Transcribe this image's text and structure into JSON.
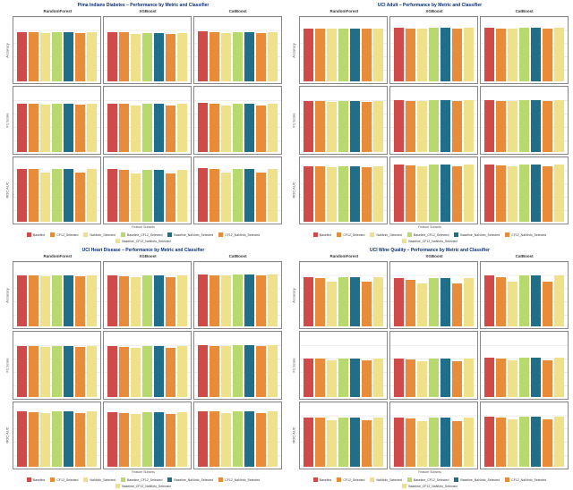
{
  "colors": [
    "#d14a4a",
    "#e98c3a",
    "#efe08a",
    "#b7d96e",
    "#1f6f8b",
    "#e98c3a",
    "#efe08a",
    "#1f6f8b"
  ],
  "panels": [
    {
      "title": "Pima Indians Diabetes – Performance by Metric and Classifier"
    },
    {
      "title": "UCI Adult – Performance by Metric and Classifier"
    },
    {
      "title": "UCI Heart Disease – Performance by Metric and Classifier"
    },
    {
      "title": "UCI Wine Quality – Performance by Metric and Classifier"
    }
  ],
  "classifiers": [
    "RandomForest",
    "XGBoost",
    "CatBoost"
  ],
  "metrics": [
    "Accuracy",
    "F1 Score",
    "ROC AUC"
  ],
  "x_axis_title": "Feature Subsets",
  "feature_subsets": [
    "Baseline",
    "CF12_Selected",
    "NaNInfo_Selected",
    "Baseline_CF12_Selected",
    "Baseline_NaNInfo_Selected",
    "CF12_NaNInfo_Selected",
    "Baseline_CF12_NaNInfo_Selected"
  ],
  "chart_data": [
    {
      "dataset": "Pima Indians Diabetes",
      "type": "bar",
      "xlabel": "Feature Subsets",
      "series_names": [
        "Baseline",
        "CF12_Selected",
        "NaNInfo_Selected",
        "Baseline_CF12_Selected",
        "Baseline_NaNInfo_Selected",
        "CF12_NaNInfo_Selected",
        "Baseline_CF12_NaNInfo_Selected"
      ],
      "subplots": [
        {
          "metric": "Accuracy",
          "classifier": "RandomForest",
          "ylim": [
            0,
            1
          ],
          "values": [
            0.8,
            0.8,
            0.79,
            0.8,
            0.8,
            0.79,
            0.8
          ]
        },
        {
          "metric": "Accuracy",
          "classifier": "XGBoost",
          "ylim": [
            0,
            1
          ],
          "values": [
            0.8,
            0.8,
            0.77,
            0.79,
            0.79,
            0.77,
            0.79
          ]
        },
        {
          "metric": "Accuracy",
          "classifier": "CatBoost",
          "ylim": [
            0,
            1
          ],
          "values": [
            0.81,
            0.8,
            0.78,
            0.8,
            0.8,
            0.78,
            0.8
          ]
        },
        {
          "metric": "F1 Score",
          "classifier": "RandomForest",
          "ylim": [
            0,
            1
          ],
          "values": [
            0.78,
            0.78,
            0.76,
            0.78,
            0.78,
            0.76,
            0.78
          ]
        },
        {
          "metric": "F1 Score",
          "classifier": "XGBoost",
          "ylim": [
            0,
            1
          ],
          "values": [
            0.78,
            0.78,
            0.74,
            0.77,
            0.77,
            0.74,
            0.77
          ]
        },
        {
          "metric": "F1 Score",
          "classifier": "CatBoost",
          "ylim": [
            0,
            1
          ],
          "values": [
            0.79,
            0.78,
            0.75,
            0.78,
            0.78,
            0.75,
            0.78
          ]
        },
        {
          "metric": "ROC AUC",
          "classifier": "RandomForest",
          "ylim": [
            0,
            1
          ],
          "values": [
            0.85,
            0.85,
            0.8,
            0.85,
            0.85,
            0.8,
            0.85
          ]
        },
        {
          "metric": "ROC AUC",
          "classifier": "XGBoost",
          "ylim": [
            0,
            1
          ],
          "values": [
            0.85,
            0.84,
            0.78,
            0.84,
            0.84,
            0.78,
            0.84
          ]
        },
        {
          "metric": "ROC AUC",
          "classifier": "CatBoost",
          "ylim": [
            0,
            1
          ],
          "values": [
            0.86,
            0.85,
            0.79,
            0.85,
            0.85,
            0.79,
            0.85
          ]
        }
      ]
    },
    {
      "dataset": "UCI Adult",
      "type": "bar",
      "xlabel": "Feature Subsets",
      "series_names": [
        "Baseline",
        "CF12_Selected",
        "NaNInfo_Selected",
        "Baseline_CF12_Selected",
        "Baseline_NaNInfo_Selected",
        "CF12_NaNInfo_Selected",
        "Baseline_CF12_NaNInfo_Selected"
      ],
      "subplots": [
        {
          "metric": "Accuracy",
          "classifier": "RandomForest",
          "ylim": [
            0,
            1
          ],
          "values": [
            0.86,
            0.85,
            0.85,
            0.86,
            0.86,
            0.85,
            0.86
          ]
        },
        {
          "metric": "Accuracy",
          "classifier": "XGBoost",
          "ylim": [
            0,
            1
          ],
          "values": [
            0.87,
            0.86,
            0.85,
            0.87,
            0.87,
            0.85,
            0.87
          ]
        },
        {
          "metric": "Accuracy",
          "classifier": "CatBoost",
          "ylim": [
            0,
            1
          ],
          "values": [
            0.87,
            0.86,
            0.86,
            0.87,
            0.87,
            0.86,
            0.87
          ]
        },
        {
          "metric": "F1 Score",
          "classifier": "RandomForest",
          "ylim": [
            0,
            1
          ],
          "values": [
            0.82,
            0.81,
            0.8,
            0.82,
            0.82,
            0.8,
            0.82
          ]
        },
        {
          "metric": "F1 Score",
          "classifier": "XGBoost",
          "ylim": [
            0,
            1
          ],
          "values": [
            0.83,
            0.82,
            0.81,
            0.83,
            0.83,
            0.81,
            0.83
          ]
        },
        {
          "metric": "F1 Score",
          "classifier": "CatBoost",
          "ylim": [
            0,
            1
          ],
          "values": [
            0.83,
            0.82,
            0.82,
            0.83,
            0.83,
            0.82,
            0.83
          ]
        },
        {
          "metric": "ROC AUC",
          "classifier": "RandomForest",
          "ylim": [
            0,
            1
          ],
          "values": [
            0.9,
            0.89,
            0.88,
            0.9,
            0.9,
            0.88,
            0.9
          ]
        },
        {
          "metric": "ROC AUC",
          "classifier": "XGBoost",
          "ylim": [
            0,
            1
          ],
          "values": [
            0.92,
            0.91,
            0.89,
            0.92,
            0.92,
            0.89,
            0.92
          ]
        },
        {
          "metric": "ROC AUC",
          "classifier": "CatBoost",
          "ylim": [
            0,
            1
          ],
          "values": [
            0.92,
            0.91,
            0.9,
            0.92,
            0.92,
            0.9,
            0.92
          ]
        }
      ]
    },
    {
      "dataset": "UCI Heart Disease",
      "type": "bar",
      "xlabel": "Feature Subsets",
      "series_names": [
        "Baseline",
        "CF12_Selected",
        "NaNInfo_Selected",
        "Baseline_CF12_Selected",
        "Baseline_NaNInfo_Selected",
        "CF12_NaNInfo_Selected",
        "Baseline_CF12_NaNInfo_Selected"
      ],
      "subplots": [
        {
          "metric": "Accuracy",
          "classifier": "RandomForest",
          "ylim": [
            0,
            1
          ],
          "values": [
            0.83,
            0.82,
            0.81,
            0.83,
            0.83,
            0.81,
            0.83
          ]
        },
        {
          "metric": "Accuracy",
          "classifier": "XGBoost",
          "ylim": [
            0,
            1
          ],
          "values": [
            0.82,
            0.81,
            0.8,
            0.82,
            0.82,
            0.8,
            0.82
          ]
        },
        {
          "metric": "Accuracy",
          "classifier": "CatBoost",
          "ylim": [
            0,
            1
          ],
          "values": [
            0.84,
            0.83,
            0.82,
            0.84,
            0.84,
            0.82,
            0.84
          ]
        },
        {
          "metric": "F1 Score",
          "classifier": "RandomForest",
          "ylim": [
            0,
            1
          ],
          "values": [
            0.82,
            0.81,
            0.8,
            0.82,
            0.82,
            0.8,
            0.82
          ]
        },
        {
          "metric": "F1 Score",
          "classifier": "XGBoost",
          "ylim": [
            0,
            1
          ],
          "values": [
            0.81,
            0.8,
            0.79,
            0.81,
            0.81,
            0.79,
            0.81
          ]
        },
        {
          "metric": "F1 Score",
          "classifier": "CatBoost",
          "ylim": [
            0,
            1
          ],
          "values": [
            0.83,
            0.82,
            0.81,
            0.83,
            0.83,
            0.81,
            0.83
          ]
        },
        {
          "metric": "ROC AUC",
          "classifier": "RandomForest",
          "ylim": [
            0,
            1
          ],
          "values": [
            0.89,
            0.88,
            0.86,
            0.89,
            0.89,
            0.86,
            0.89
          ]
        },
        {
          "metric": "ROC AUC",
          "classifier": "XGBoost",
          "ylim": [
            0,
            1
          ],
          "values": [
            0.88,
            0.87,
            0.85,
            0.88,
            0.88,
            0.85,
            0.88
          ]
        },
        {
          "metric": "ROC AUC",
          "classifier": "CatBoost",
          "ylim": [
            0,
            1
          ],
          "values": [
            0.9,
            0.89,
            0.87,
            0.9,
            0.9,
            0.87,
            0.9
          ]
        }
      ]
    },
    {
      "dataset": "UCI Wine Quality",
      "type": "bar",
      "xlabel": "Feature Subsets",
      "series_names": [
        "Baseline",
        "CF12_Selected",
        "NaNInfo_Selected",
        "Baseline_CF12_Selected",
        "Baseline_NaNInfo_Selected",
        "CF12_NaNInfo_Selected",
        "Baseline_CF12_NaNInfo_Selected"
      ],
      "subplots": [
        {
          "metric": "Accuracy",
          "classifier": "RandomForest",
          "ylim": [
            0,
            0.5
          ],
          "values": [
            0.4,
            0.39,
            0.36,
            0.4,
            0.4,
            0.36,
            0.4
          ]
        },
        {
          "metric": "Accuracy",
          "classifier": "XGBoost",
          "ylim": [
            0,
            0.5
          ],
          "values": [
            0.39,
            0.38,
            0.35,
            0.39,
            0.39,
            0.35,
            0.39
          ]
        },
        {
          "metric": "Accuracy",
          "classifier": "CatBoost",
          "ylim": [
            0,
            0.5
          ],
          "values": [
            0.41,
            0.4,
            0.36,
            0.41,
            0.41,
            0.36,
            0.41
          ]
        },
        {
          "metric": "F1 Score",
          "classifier": "RandomForest",
          "ylim": [
            0,
            1
          ],
          "values": [
            0.62,
            0.61,
            0.58,
            0.62,
            0.62,
            0.58,
            0.62
          ]
        },
        {
          "metric": "F1 Score",
          "classifier": "XGBoost",
          "ylim": [
            0,
            1
          ],
          "values": [
            0.61,
            0.6,
            0.57,
            0.61,
            0.61,
            0.57,
            0.61
          ]
        },
        {
          "metric": "F1 Score",
          "classifier": "CatBoost",
          "ylim": [
            0,
            1
          ],
          "values": [
            0.63,
            0.62,
            0.58,
            0.63,
            0.63,
            0.58,
            0.63
          ]
        },
        {
          "metric": "ROC AUC",
          "classifier": "RandomForest",
          "ylim": [
            0,
            1
          ],
          "values": [
            0.8,
            0.79,
            0.75,
            0.8,
            0.8,
            0.75,
            0.8
          ]
        },
        {
          "metric": "ROC AUC",
          "classifier": "XGBoost",
          "ylim": [
            0,
            1
          ],
          "values": [
            0.79,
            0.78,
            0.74,
            0.79,
            0.79,
            0.74,
            0.79
          ]
        },
        {
          "metric": "ROC AUC",
          "classifier": "CatBoost",
          "ylim": [
            0,
            1
          ],
          "values": [
            0.81,
            0.8,
            0.76,
            0.81,
            0.81,
            0.76,
            0.81
          ]
        }
      ]
    }
  ]
}
